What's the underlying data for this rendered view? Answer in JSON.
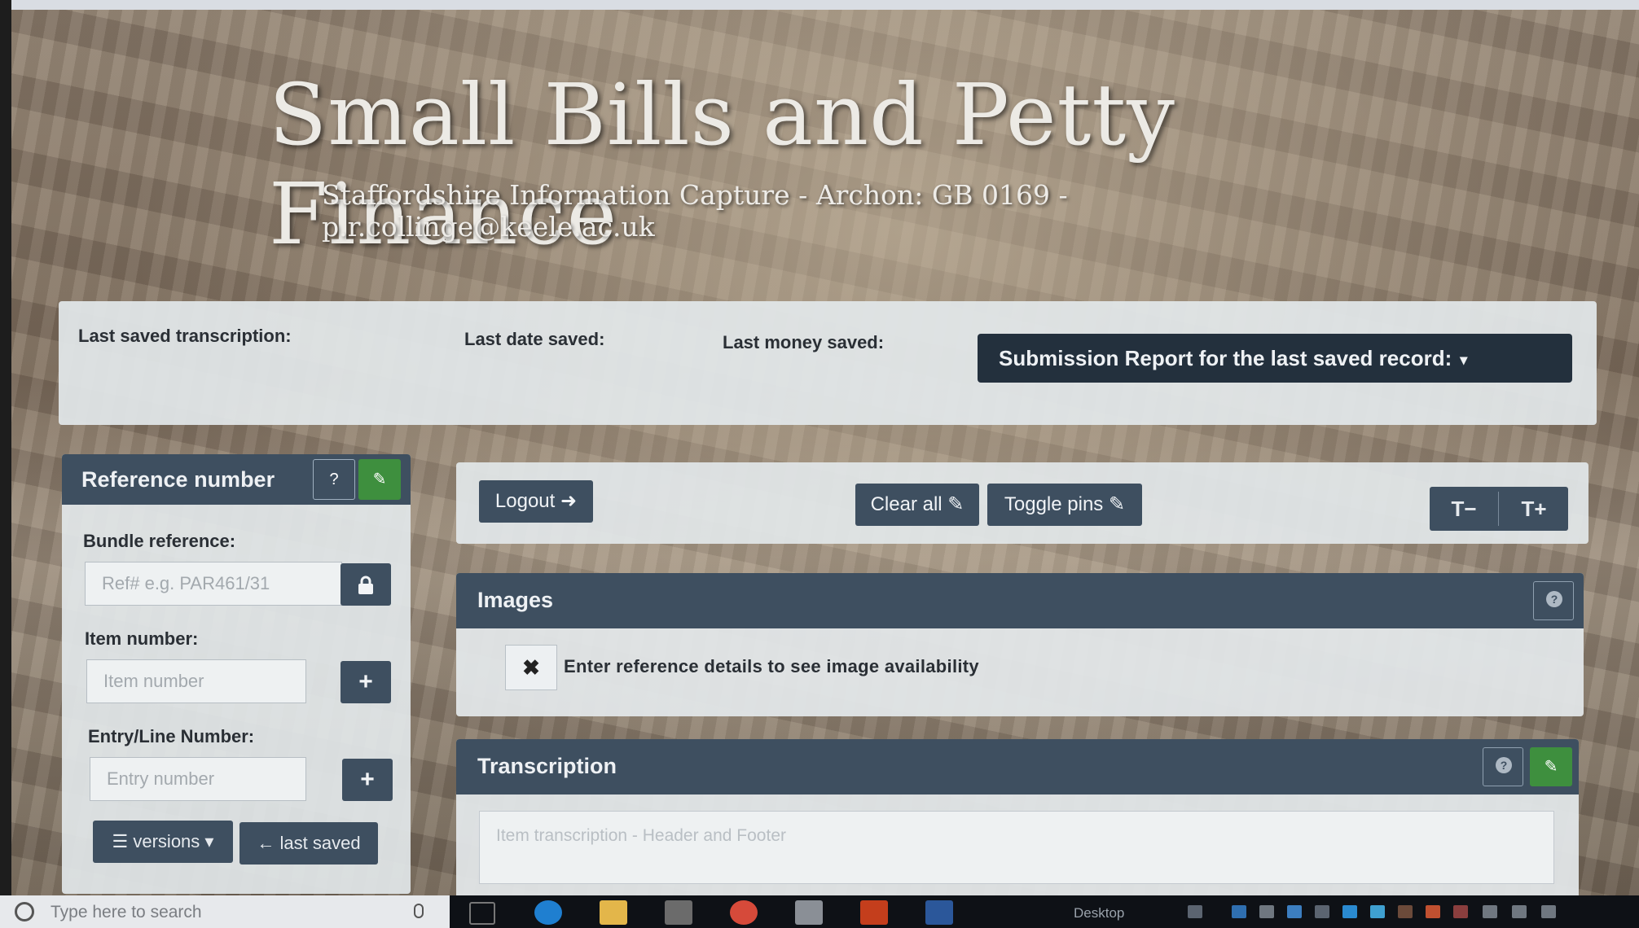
{
  "header": {
    "title": "Small Bills and Petty Finance",
    "subtitle": "Staffordshire Information Capture - Archon: GB 0169 - p.r.collinge@keele.ac.uk"
  },
  "status": {
    "last_transcription_label": "Last saved transcription:",
    "last_date_label": "Last date saved:",
    "last_money_label": "Last money saved:",
    "report_button": "Submission Report for the last saved record:"
  },
  "reference": {
    "title": "Reference number",
    "bundle_label": "Bundle reference:",
    "bundle_placeholder": "Ref# e.g. PAR461/31",
    "item_label": "Item number:",
    "item_placeholder": "Item number",
    "entry_label": "Entry/Line Number:",
    "entry_placeholder": "Entry number",
    "versions_button": "versions",
    "last_saved_button": "last saved"
  },
  "toolbar": {
    "logout": "Logout",
    "clear_all": "Clear all",
    "toggle_pins": "Toggle pins",
    "font_decrease": "T−",
    "font_increase": "T+"
  },
  "images": {
    "title": "Images",
    "message": "Enter reference details to see image availability"
  },
  "transcription": {
    "title": "Transcription",
    "placeholder": "Item transcription - Header and Footer"
  },
  "taskbar": {
    "search_placeholder": "Type here to search",
    "desktop_label": "Desktop"
  },
  "colors": {
    "panel_header": "#3e4f60",
    "report_button": "#23303d",
    "pin_active": "#3e8f3e"
  }
}
